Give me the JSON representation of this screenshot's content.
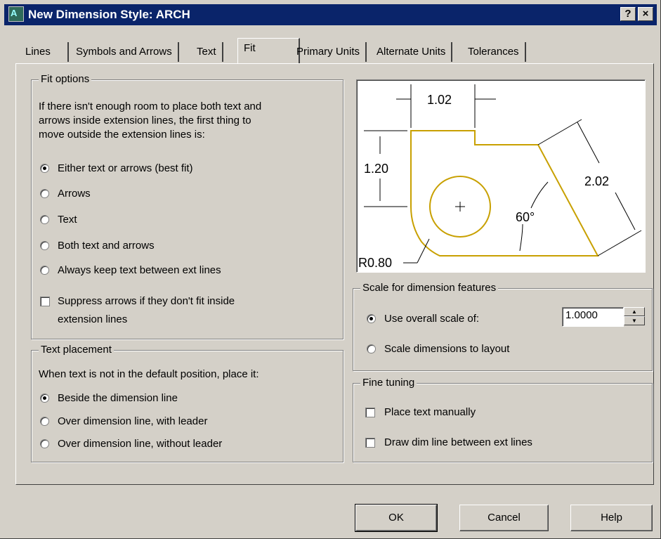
{
  "window": {
    "title": "New Dimension Style: ARCH",
    "help_btn": "?",
    "close_btn": "×"
  },
  "tabs": [
    {
      "label": "Lines"
    },
    {
      "label": "Symbols and Arrows"
    },
    {
      "label": "Text"
    },
    {
      "label": "Fit"
    },
    {
      "label": "Primary Units"
    },
    {
      "label": "Alternate Units"
    },
    {
      "label": "Tolerances"
    }
  ],
  "active_tab": "Fit",
  "fit_options": {
    "legend": "Fit options",
    "desc1": "If there isn't enough room to place both text and",
    "desc2": "arrows inside extension lines, the first thing to",
    "desc3": "move outside the extension lines is:",
    "options": [
      {
        "label": "Either text or arrows (best fit)",
        "selected": true
      },
      {
        "label": "Arrows",
        "selected": false
      },
      {
        "label": "Text",
        "selected": false
      },
      {
        "label": "Both text and arrows",
        "selected": false
      },
      {
        "label": "Always keep text between ext lines",
        "selected": false
      }
    ],
    "suppress_line1": "Suppress arrows if they don't fit inside",
    "suppress_line2": "extension lines",
    "suppress_checked": false
  },
  "text_placement": {
    "legend": "Text placement",
    "desc": "When text is not in the default position, place it:",
    "options": [
      {
        "label": "Beside the dimension line",
        "selected": true
      },
      {
        "label": "Over dimension line, with leader",
        "selected": false
      },
      {
        "label": "Over dimension line, without leader",
        "selected": false
      }
    ]
  },
  "preview": {
    "dim_top": "1.02",
    "dim_left": "1.20",
    "dim_right": "2.02",
    "dim_angle": "60°",
    "dim_radius": "R0.80",
    "outline_color": "#c8a000"
  },
  "scale": {
    "legend": "Scale for dimension features",
    "use_overall": "Use overall scale of:",
    "use_overall_selected": true,
    "scale_value": "1.0000",
    "scale_layout": "Scale dimensions to layout",
    "scale_layout_selected": false
  },
  "fine_tuning": {
    "legend": "Fine tuning",
    "place_manual": "Place text manually",
    "place_manual_checked": false,
    "draw_dim": "Draw dim line between ext lines",
    "draw_dim_checked": false
  },
  "buttons": {
    "ok": "OK",
    "cancel": "Cancel",
    "help": "Help"
  }
}
